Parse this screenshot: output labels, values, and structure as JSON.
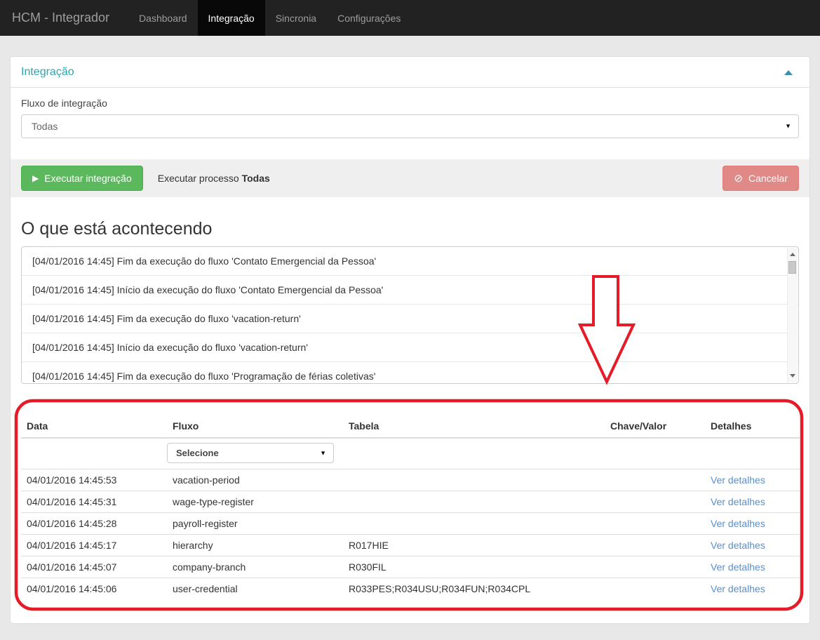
{
  "navbar": {
    "brand": "HCM - Integrador",
    "items": [
      {
        "label": "Dashboard",
        "active": false
      },
      {
        "label": "Integração",
        "active": true
      },
      {
        "label": "Sincronia",
        "active": false
      },
      {
        "label": "Configurações",
        "active": false
      }
    ]
  },
  "panel": {
    "title": "Integração",
    "form": {
      "label": "Fluxo de integração",
      "selected_value": "Todas"
    },
    "toolbar": {
      "execute_label": "Executar integração",
      "process_text": "Executar processo",
      "process_value": "Todas",
      "cancel_label": "Cancelar"
    }
  },
  "activity": {
    "heading": "O que está acontecendo",
    "log": [
      "[04/01/2016 14:45] Fim da execução do fluxo 'Contato Emergencial da Pessoa'",
      "[04/01/2016 14:45] Início da execução do fluxo 'Contato Emergencial da Pessoa'",
      "[04/01/2016 14:45] Fim da execução do fluxo 'vacation-return'",
      "[04/01/2016 14:45] Início da execução do fluxo 'vacation-return'",
      "[04/01/2016 14:45] Fim da execução do fluxo 'Programação de férias coletivas'"
    ]
  },
  "table": {
    "headers": [
      "Data",
      "Fluxo",
      "Tabela",
      "Chave/Valor",
      "Detalhes"
    ],
    "filter_value": "Selecione",
    "rows": [
      {
        "data": "04/01/2016 14:45:53",
        "fluxo": "vacation-period",
        "tabela": "",
        "chave": "",
        "detalhes": "Ver detalhes"
      },
      {
        "data": "04/01/2016 14:45:31",
        "fluxo": "wage-type-register",
        "tabela": "",
        "chave": "",
        "detalhes": "Ver detalhes"
      },
      {
        "data": "04/01/2016 14:45:28",
        "fluxo": "payroll-register",
        "tabela": "",
        "chave": "",
        "detalhes": "Ver detalhes"
      },
      {
        "data": "04/01/2016 14:45:17",
        "fluxo": "hierarchy",
        "tabela": "R017HIE",
        "chave": "",
        "detalhes": "Ver detalhes"
      },
      {
        "data": "04/01/2016 14:45:07",
        "fluxo": "company-branch",
        "tabela": "R030FIL",
        "chave": "",
        "detalhes": "Ver detalhes"
      },
      {
        "data": "04/01/2016 14:45:06",
        "fluxo": "user-credential",
        "tabela": "R033PES;R034USU;R034FUN;R034CPL",
        "chave": "",
        "detalhes": "Ver detalhes"
      }
    ]
  },
  "icons": {
    "play": "▶",
    "ban": "⊘",
    "caret_down": "▼"
  },
  "colors": {
    "navbar_bg": "#222222",
    "navbar_active_bg": "#080808",
    "panel_title_teal": "#2fa4af",
    "success_green": "#5cb85c",
    "danger_red": "#d9534f",
    "link_blue": "#5a8fcd",
    "annotation_red": "#e61b27",
    "page_bg": "#e8e8e9"
  }
}
